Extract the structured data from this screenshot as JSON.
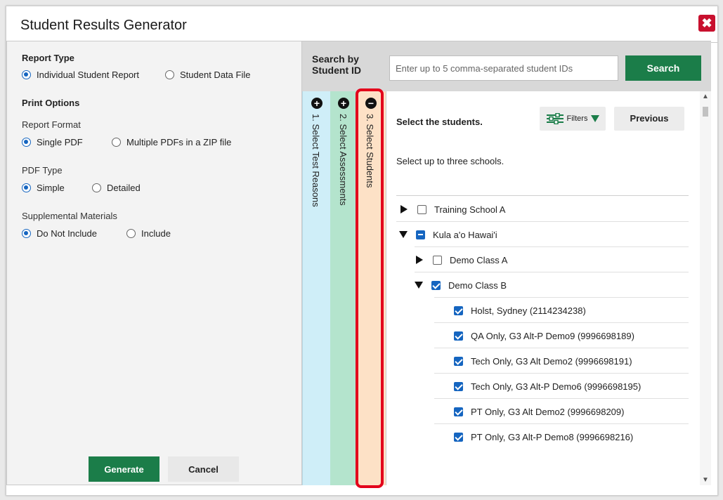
{
  "dialog": {
    "title": "Student Results Generator",
    "close_label": "✖"
  },
  "report_type": {
    "heading": "Report Type",
    "options": [
      {
        "label": "Individual Student Report",
        "selected": true
      },
      {
        "label": "Student Data File",
        "selected": false
      }
    ]
  },
  "print_options": {
    "heading": "Print Options",
    "report_format": {
      "label": "Report Format",
      "options": [
        {
          "label": "Single PDF",
          "selected": true
        },
        {
          "label": "Multiple PDFs in a ZIP file",
          "selected": false
        }
      ]
    },
    "pdf_type": {
      "label": "PDF Type",
      "options": [
        {
          "label": "Simple",
          "selected": true
        },
        {
          "label": "Detailed",
          "selected": false
        }
      ]
    },
    "supplemental": {
      "label": "Supplemental Materials",
      "options": [
        {
          "label": "Do Not Include",
          "selected": true
        },
        {
          "label": "Include",
          "selected": false
        }
      ]
    }
  },
  "buttons": {
    "generate": "Generate",
    "cancel": "Cancel"
  },
  "search": {
    "label_line1": "Search by",
    "label_line2": "Student ID",
    "placeholder": "Enter up to 5 comma-separated student IDs",
    "button": "Search"
  },
  "tabs": [
    {
      "label": "1. Select Test Reasons",
      "icon": "plus-circle-icon"
    },
    {
      "label": "2. Select Assessments",
      "icon": "plus-circle-icon"
    },
    {
      "label": "3. Select Students",
      "icon": "minus-circle-icon"
    }
  ],
  "students_panel": {
    "title": "Select the students.",
    "filters_label": "Filters",
    "previous_label": "Previous",
    "note": "Select up to three schools.",
    "tree": [
      {
        "label": "Training School A",
        "level": 0,
        "expanded": false,
        "state": "unchecked"
      },
      {
        "label": "Kula a'o Hawai'i",
        "level": 0,
        "expanded": true,
        "state": "partial"
      },
      {
        "label": "Demo Class A",
        "level": 1,
        "expanded": false,
        "state": "unchecked"
      },
      {
        "label": "Demo Class B",
        "level": 1,
        "expanded": true,
        "state": "checked"
      },
      {
        "label": "Holst, Sydney (2114234238)",
        "level": 2,
        "state": "checked"
      },
      {
        "label": "QA Only, G3 Alt-P Demo9 (9996698189)",
        "level": 2,
        "state": "checked"
      },
      {
        "label": "Tech Only, G3 Alt Demo2 (9996698191)",
        "level": 2,
        "state": "checked"
      },
      {
        "label": "Tech Only, G3 Alt-P Demo6 (9996698195)",
        "level": 2,
        "state": "checked"
      },
      {
        "label": "PT Only, G3 Alt Demo2 (9996698209)",
        "level": 2,
        "state": "checked"
      },
      {
        "label": "PT Only, G3 Alt-P Demo8 (9996698216)",
        "level": 2,
        "state": "checked"
      }
    ]
  },
  "colors": {
    "primary_green": "#1b7d49",
    "close_red": "#c8102e",
    "checkbox_blue": "#1565c0",
    "tab1_bg": "#cfeef8",
    "tab2_bg": "#b4e4cd",
    "tab3_bg": "#fde1c6",
    "highlight_red": "#e3001b"
  }
}
